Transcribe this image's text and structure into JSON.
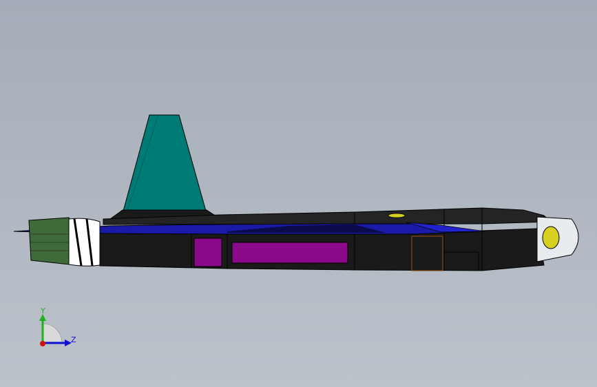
{
  "viewport": {
    "background_top": "#a3acb8",
    "background_bottom": "#bcc2ca"
  },
  "model": {
    "colors": {
      "body": "#1c1c1c",
      "body_edge": "#000000",
      "tail_fin": "#007a74",
      "wing": "#1a1aa8",
      "bay_panel": "#8a0a8a",
      "nozzle": "#3f6b3a",
      "canopy_glass": "#e8ecf0",
      "canopy_bulb": "#d8d020",
      "hatch_outline": "#8a4a18"
    }
  },
  "triad": {
    "y_label": "Y",
    "z_label": "Z",
    "y_color": "#20b020",
    "z_color": "#1010d0",
    "x_color": "#d01010"
  }
}
